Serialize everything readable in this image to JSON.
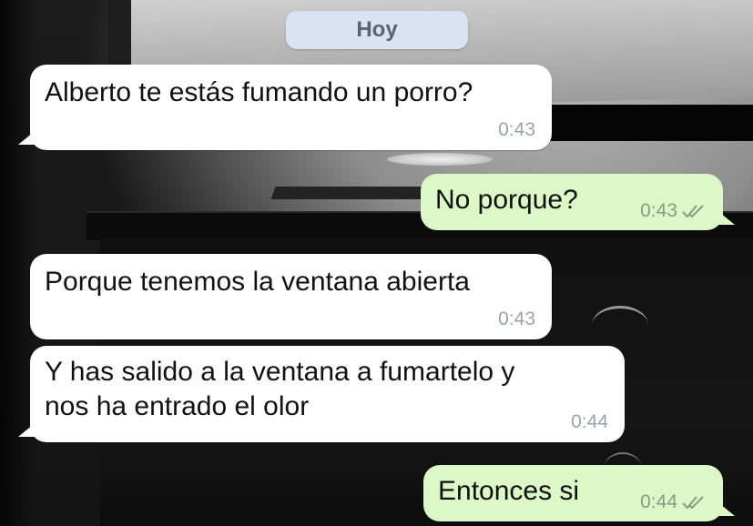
{
  "chat": {
    "date_label": "Hoy",
    "messages": [
      {
        "direction": "in",
        "text": "Alberto te estás fumando un porro?",
        "time": "0:43",
        "read": false
      },
      {
        "direction": "out",
        "text": "No porque?",
        "time": "0:43",
        "read": true
      },
      {
        "direction": "in",
        "text": "Porque tenemos la ventana abierta",
        "time": "0:43",
        "read": false
      },
      {
        "direction": "in",
        "text_lines": [
          "Y has salido a la ventana a fumartelo y",
          "nos ha entrado el olor"
        ],
        "time": "0:44",
        "read": false
      },
      {
        "direction": "out",
        "text": "Entonces si",
        "time": "0:44",
        "read": true
      }
    ]
  },
  "colors": {
    "incoming_bubble": "#ffffff",
    "outgoing_bubble": "#dcf8c6",
    "date_pill": "#d9e4f2",
    "timestamp": "#9aa3ad",
    "read_ticks": "#8a9a86"
  },
  "icons": {
    "read_receipt": "double-check-icon"
  }
}
